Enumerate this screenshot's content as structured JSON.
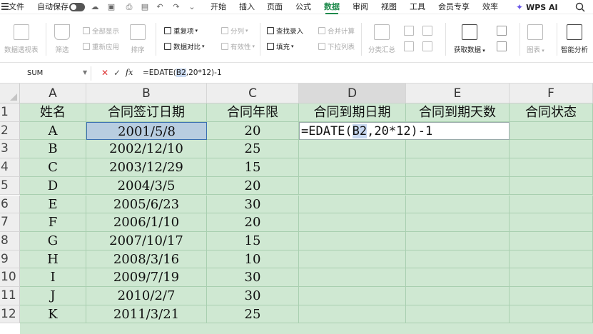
{
  "menu": {
    "file": "文件",
    "autosave": "自动保存",
    "tabs": [
      "开始",
      "插入",
      "页面",
      "公式",
      "数据",
      "审阅",
      "视图",
      "工具",
      "会员专享",
      "效率"
    ],
    "active_tab": "数据",
    "wps_ai": "WPS AI"
  },
  "ribbon": {
    "pivot": "数据透视表",
    "filter": "筛选",
    "show_all": "全部显示",
    "reapply": "重新应用",
    "sort": "排序",
    "duplicates": "重复项",
    "compare": "数据对比",
    "split": "分列",
    "validity": "有效性",
    "find_entry": "查找录入",
    "fill": "填充",
    "merge_calc": "合并计算",
    "dropdown_list": "下拉列表",
    "subtotal": "分类汇总",
    "get_data": "获取数据",
    "chart": "图表",
    "smart_analysis": "智能分析"
  },
  "formula_bar": {
    "name_box": "SUM",
    "fx": "fx",
    "formula_prefix": "=EDATE(",
    "formula_ref": "B2",
    "formula_suffix": ",20*12)-1"
  },
  "columns": [
    "A",
    "B",
    "C",
    "D",
    "E",
    "F"
  ],
  "selected_column": "D",
  "row_numbers": [
    "1",
    "2",
    "3",
    "4",
    "5",
    "6",
    "7",
    "8",
    "9",
    "10",
    "11",
    "12"
  ],
  "table": {
    "headers": [
      "姓名",
      "合同签订日期",
      "合同年限",
      "合同到期日期",
      "合同到期天数",
      "合同状态"
    ],
    "rows": [
      [
        "A",
        "2001/5/8",
        "20"
      ],
      [
        "B",
        "2002/12/10",
        "25"
      ],
      [
        "C",
        "2003/12/29",
        "15"
      ],
      [
        "D",
        "2004/3/5",
        "20"
      ],
      [
        "E",
        "2005/6/23",
        "30"
      ],
      [
        "F",
        "2006/1/10",
        "20"
      ],
      [
        "G",
        "2007/10/17",
        "15"
      ],
      [
        "H",
        "2008/3/16",
        "10"
      ],
      [
        "I",
        "2009/7/19",
        "30"
      ],
      [
        "J",
        "2010/2/7",
        "30"
      ],
      [
        "K",
        "2011/3/21",
        "25"
      ]
    ],
    "editing_cell": {
      "prefix": "=EDATE(",
      "ref": "B2",
      "suffix": ",20*12)-1"
    }
  }
}
